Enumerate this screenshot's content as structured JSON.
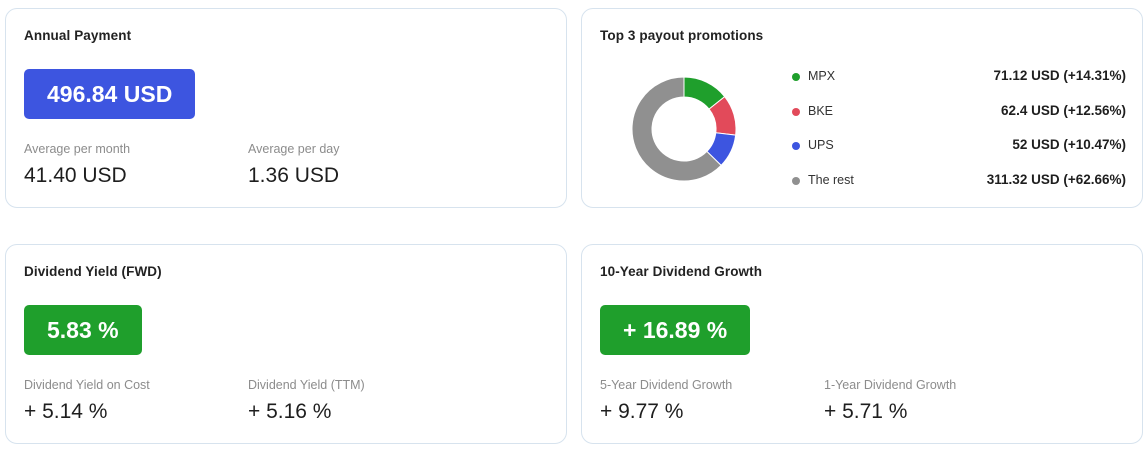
{
  "annual_payment": {
    "title": "Annual Payment",
    "badge": "496.84 USD",
    "stats": [
      {
        "label": "Average per month",
        "value": "41.40 USD"
      },
      {
        "label": "Average per day",
        "value": "1.36 USD"
      }
    ]
  },
  "top_promotions": {
    "title": "Top 3 payout promotions",
    "items": [
      {
        "name": "MPX",
        "value": "71.12 USD (+14.31%)",
        "amount": 71.12,
        "color": "#1f9f2c"
      },
      {
        "name": "BKE",
        "value": "62.4 USD (+12.56%)",
        "amount": 62.4,
        "color": "#e24a5a"
      },
      {
        "name": "UPS",
        "value": "52 USD (+10.47%)",
        "amount": 52,
        "color": "#3d55e0"
      },
      {
        "name": "The rest",
        "value": "311.32 USD (+62.66%)",
        "amount": 311.32,
        "color": "#909090"
      }
    ]
  },
  "dividend_yield": {
    "title": "Dividend Yield (FWD)",
    "badge": "5.83 %",
    "stats": [
      {
        "label": "Dividend Yield on Cost",
        "value": "+ 5.14 %"
      },
      {
        "label": "Dividend Yield (TTM)",
        "value": "+ 5.16 %"
      }
    ]
  },
  "dividend_growth": {
    "title": "10-Year Dividend Growth",
    "badge": "+ 16.89 %",
    "stats": [
      {
        "label": "5-Year Dividend Growth",
        "value": "+ 9.77 %"
      },
      {
        "label": "1-Year Dividend Growth",
        "value": "+ 5.71 %"
      }
    ]
  },
  "colors": {
    "blue_badge": "#3d55e0",
    "green_badge": "#1f9f2c",
    "card_border": "#d7e3ee"
  }
}
